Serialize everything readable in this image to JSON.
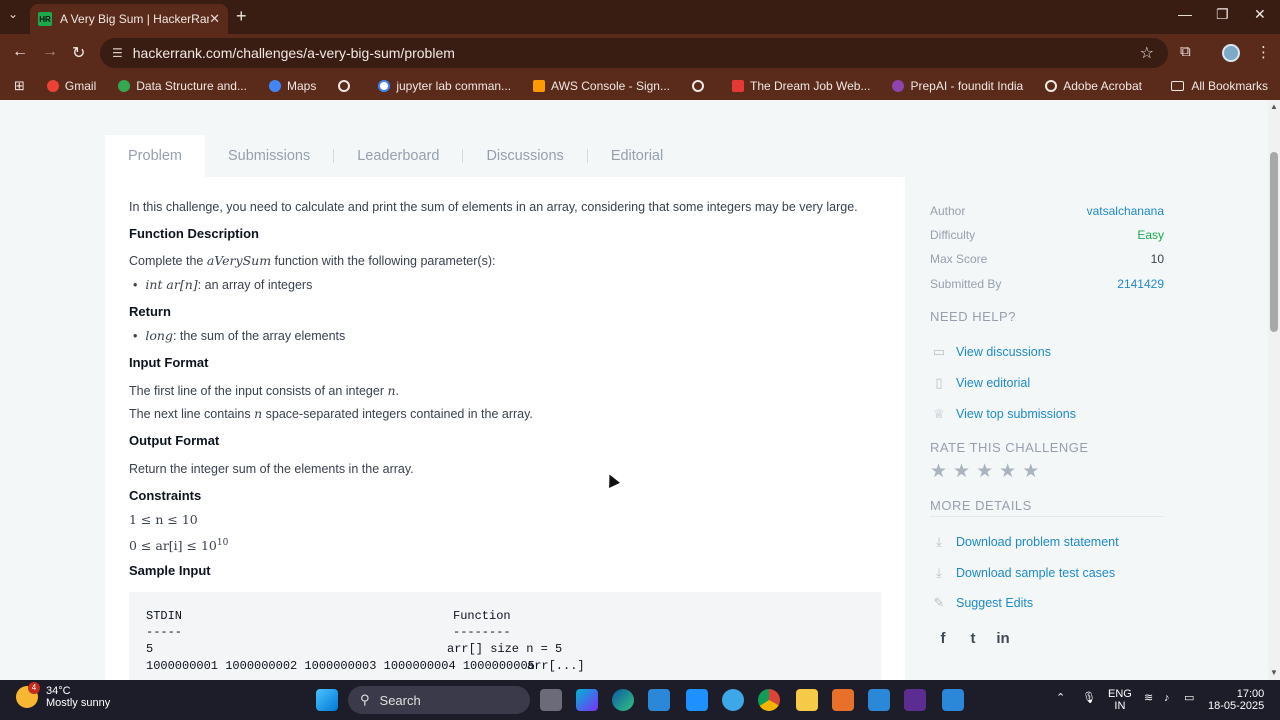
{
  "browser": {
    "tab_title": "A Very Big Sum | HackerRank",
    "tab_favicon": "HR",
    "url": "hackerrank.com/challenges/a-very-big-sum/problem",
    "bookmarks": [
      "Gmail",
      "Data Structure and...",
      "Maps",
      "",
      "jupyter lab comman...",
      "AWS Console - Sign...",
      "",
      "The Dream Job Web...",
      "PrepAI - foundit India",
      "Adobe Acrobat"
    ],
    "all_bookmarks": "All Bookmarks"
  },
  "tabs": [
    "Problem",
    "Submissions",
    "Leaderboard",
    "Discussions",
    "Editorial"
  ],
  "problem": {
    "intro": "In this challenge, you need to calculate and print the sum of elements in an array, considering that some integers may be very large.",
    "func_desc_heading": "Function Description",
    "func_desc_pre": "Complete the ",
    "func_name": "aVerySum",
    "func_desc_post": " function with the following parameter(s):",
    "param_math": "int ar[n]",
    "param_text": ": an array of integers",
    "return_heading": "Return",
    "return_math": "long",
    "return_text": ": the sum of the array elements",
    "input_heading": "Input Format",
    "input_line1_pre": "The first line of the input consists of an integer ",
    "input_line1_math": "n",
    "input_line1_post": ".",
    "input_line2_pre": "The next line contains ",
    "input_line2_math": "n",
    "input_line2_post": " space-separated integers contained in the array.",
    "output_heading": "Output Format",
    "output_text": "Return the integer sum of the elements in the array.",
    "constraints_heading": "Constraints",
    "constraint1": "1 ≤ n ≤ 10",
    "constraint2_pre": "0 ≤ ar[i] ≤ 10",
    "constraint2_sup": "10",
    "sample_heading": "Sample Input",
    "sample": {
      "col1_header": "STDIN",
      "col2_header": "Function",
      "col1_dash": "-----",
      "col2_dash": "--------",
      "row1_left": "5",
      "row1_right": "arr[] size n = 5",
      "row2_left": "1000000001 1000000002 1000000003 1000000004 1000000005",
      "row2_right": "arr[...]"
    }
  },
  "sidebar": {
    "author_label": "Author",
    "author_value": "vatsalchanana",
    "difficulty_label": "Difficulty",
    "difficulty_value": "Easy",
    "max_score_label": "Max Score",
    "max_score_value": "10",
    "submitted_label": "Submitted By",
    "submitted_value": "2141429",
    "need_help": "NEED HELP?",
    "help_links": [
      "View discussions",
      "View editorial",
      "View top submissions"
    ],
    "rate": "RATE THIS CHALLENGE",
    "rating": 0,
    "more_details": "MORE DETAILS",
    "detail_links": [
      "Download problem statement",
      "Download sample test cases",
      "Suggest Edits"
    ]
  },
  "taskbar": {
    "weather_temp": "34°C",
    "weather_desc": "Mostly sunny",
    "weather_badge": "4",
    "search": "Search",
    "lang1": "ENG",
    "lang2": "IN",
    "time": "17:00",
    "date": "18-05-2025"
  },
  "colors": {
    "link": "#1f8acb",
    "easy": "#1ba94c",
    "chrome": "#5a2a1a"
  }
}
